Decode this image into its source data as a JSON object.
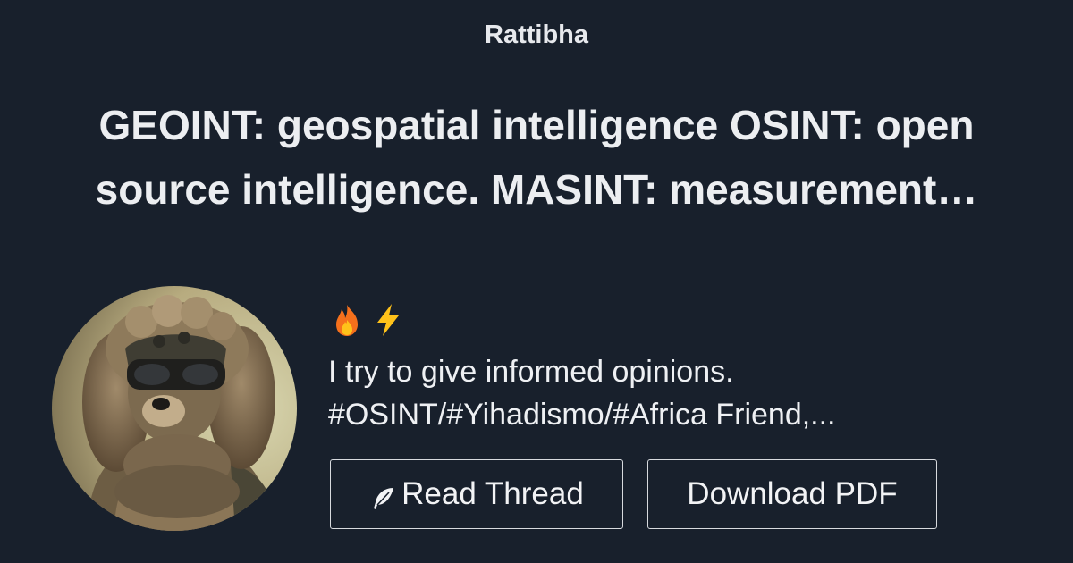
{
  "site": {
    "name": "Rattibha"
  },
  "thread": {
    "title_line1": "GEOINT: geospatial intelligence OSINT: open",
    "title_line2": "source intelligence. MASINT: measurement…"
  },
  "author": {
    "emojis": [
      "fire-emoji",
      "lightning-emoji"
    ],
    "bio_line1": "I try to give informed opinions.",
    "bio_line2": "#OSINT/#Yihadismo/#Africa Friend,..."
  },
  "actions": {
    "read_label": "Read Thread",
    "read_icon": "feather-icon",
    "download_label": "Download PDF"
  },
  "colors": {
    "background": "#18202c",
    "text": "#f2f3f5",
    "button_border": "#d7dade",
    "fire": "#f5701c",
    "lightning": "#ffc21a"
  }
}
